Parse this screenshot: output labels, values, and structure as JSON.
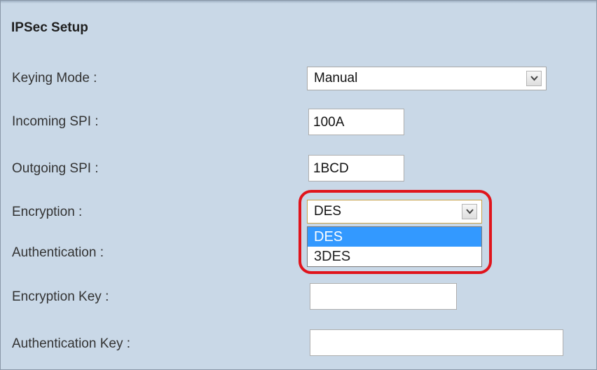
{
  "title": "IPSec Setup",
  "fields": {
    "keying_mode": {
      "label": "Keying Mode :",
      "value": "Manual"
    },
    "incoming_spi": {
      "label": "Incoming SPI :",
      "value": "100A"
    },
    "outgoing_spi": {
      "label": "Outgoing SPI :",
      "value": "1BCD"
    },
    "encryption": {
      "label": "Encryption :",
      "value": "DES",
      "options": [
        "DES",
        "3DES"
      ],
      "highlighted_option": "DES"
    },
    "authentication": {
      "label": "Authentication :"
    },
    "encryption_key": {
      "label": "Encryption Key :",
      "value": ""
    },
    "authentication_key": {
      "label": "Authentication Key :",
      "value": ""
    }
  },
  "colors": {
    "background": "#c9d8e7",
    "highlight_ring": "#e0141c",
    "selected_option": "#3399ff"
  },
  "icons": {
    "select_arrow": "chevron-down-icon"
  }
}
